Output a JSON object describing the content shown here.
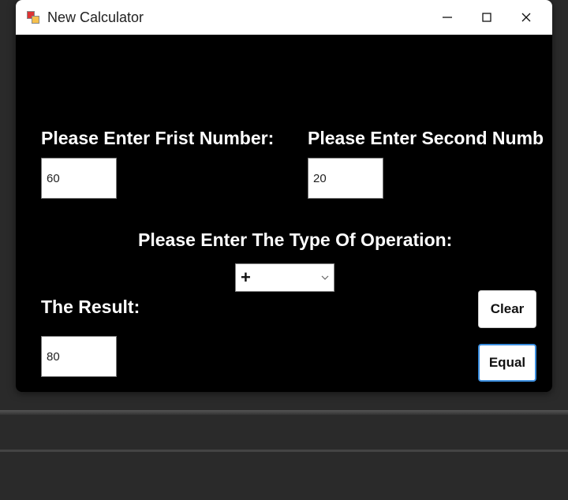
{
  "window": {
    "title": "New Calculator"
  },
  "labels": {
    "first": "Please Enter Frist Number:",
    "second": "Please Enter Second Numb",
    "operation": "Please Enter The Type Of Operation:",
    "result": "The Result:"
  },
  "inputs": {
    "first_value": "60",
    "second_value": "20",
    "result_value": "80"
  },
  "combo": {
    "selected": "+"
  },
  "buttons": {
    "clear": "Clear",
    "equal": "Equal"
  }
}
